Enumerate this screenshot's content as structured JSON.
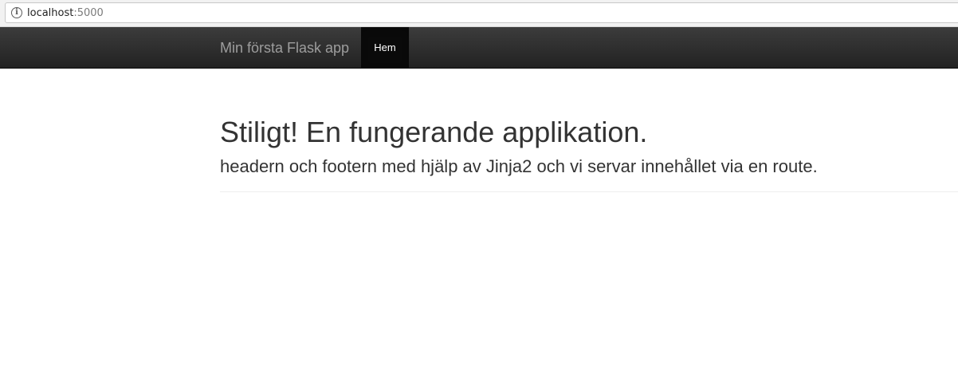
{
  "browser": {
    "url_host": "localhost",
    "url_port": ":5000",
    "info_icon": "info-icon"
  },
  "navbar": {
    "brand": "Min första Flask app",
    "items": [
      {
        "label": "Hem",
        "active": true
      }
    ],
    "colors": {
      "background": "#222222",
      "brand": "#9d9d9d",
      "active_bg": "#0a0a0a",
      "active_text": "#ffffff"
    }
  },
  "main": {
    "headline": "Stiligt! En fungerande applikation.",
    "lead": "headern och footern med hjälp av Jinja2 och vi servar innehållet via en route."
  }
}
